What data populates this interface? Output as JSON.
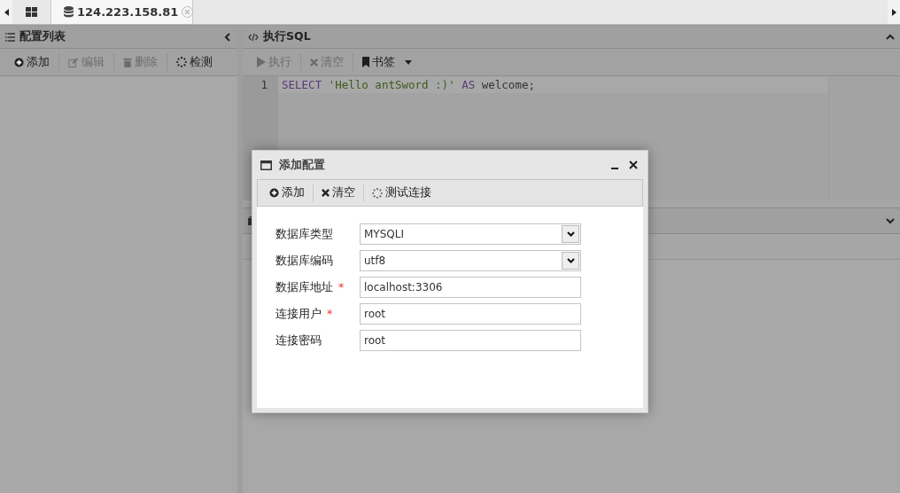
{
  "tabbar": {
    "tabs": [
      {
        "label": "124.223.158.81",
        "selected": true
      }
    ]
  },
  "left_panel": {
    "title": "配置列表",
    "toolbar": [
      {
        "label": "添加",
        "kind": "add",
        "disabled": false
      },
      {
        "label": "编辑",
        "kind": "edit",
        "disabled": true
      },
      {
        "label": "删除",
        "kind": "delete",
        "disabled": true
      },
      {
        "label": "检测",
        "kind": "check",
        "disabled": false
      }
    ]
  },
  "sql_panel": {
    "title": "执行SQL",
    "toolbar": [
      {
        "label": "执行",
        "kind": "run",
        "disabled": true,
        "dropdown": false
      },
      {
        "label": "清空",
        "kind": "clear",
        "disabled": true,
        "dropdown": false
      },
      {
        "label": "书签",
        "kind": "bookmark",
        "disabled": false,
        "dropdown": true
      }
    ],
    "editor": {
      "lines": [
        {
          "number": "1",
          "tokens": [
            {
              "kind": "keyword",
              "text": "SELECT"
            },
            {
              "kind": "string",
              "text": "'Hello antSword :)'"
            },
            {
              "kind": "keyword",
              "text": "AS"
            },
            {
              "kind": "plain",
              "text": "welcome;"
            }
          ]
        }
      ]
    }
  },
  "dialog": {
    "title": "添加配置",
    "toolbar": [
      {
        "label": "添加",
        "kind": "add"
      },
      {
        "label": "清空",
        "kind": "clear"
      },
      {
        "label": "测试连接",
        "kind": "check"
      }
    ],
    "fields": [
      {
        "label": "数据库类型",
        "kind": "select",
        "value": "MYSQLI"
      },
      {
        "label": "数据库编码",
        "kind": "select",
        "value": "utf8"
      },
      {
        "label": "数据库地址",
        "kind": "text",
        "value": "localhost:3306",
        "required_mark": "*"
      },
      {
        "label": "连接用户",
        "kind": "text",
        "value": "root",
        "required_mark": "*"
      },
      {
        "label": "连接密码",
        "kind": "text",
        "value": "root"
      }
    ]
  }
}
